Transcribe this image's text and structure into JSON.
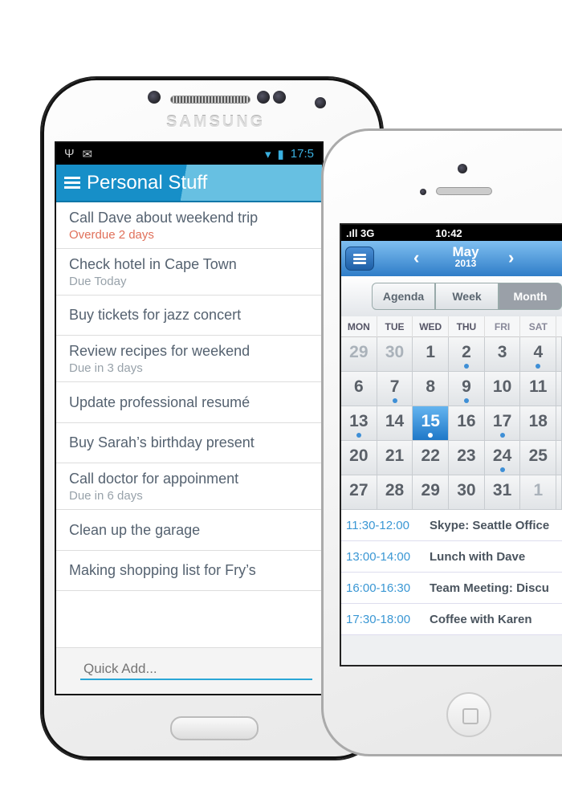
{
  "android": {
    "brand": "SAMSUNG",
    "status": {
      "time": "17:5"
    },
    "header": {
      "title": "Personal Stuff"
    },
    "tasks": [
      {
        "title": "Call Dave about weekend trip",
        "sub": "Overdue 2 days",
        "overdue": true
      },
      {
        "title": "Check hotel in Cape Town",
        "sub": "Due Today"
      },
      {
        "title": "Buy tickets for jazz concert"
      },
      {
        "title": "Review recipes for weekend",
        "sub": "Due in 3 days"
      },
      {
        "title": "Update professional resumé"
      },
      {
        "title": "Buy Sarah’s birthday present"
      },
      {
        "title": "Call doctor for appoinment",
        "sub": "Due in 6 days"
      },
      {
        "title": "Clean up the garage"
      },
      {
        "title": "Making shopping list for Fry’s"
      }
    ],
    "quick_add": {
      "placeholder": "Quick Add..."
    }
  },
  "iphone": {
    "status": {
      "signal": ".ıll 3G",
      "time": "10:42"
    },
    "nav": {
      "month": "May",
      "year": "2013",
      "prev": "‹",
      "next": "›"
    },
    "tabs": [
      {
        "label": "Agenda"
      },
      {
        "label": "Week"
      },
      {
        "label": "Month",
        "active": true
      }
    ],
    "weekdays": [
      "MON",
      "TUE",
      "WED",
      "THU",
      "FRI",
      "SAT"
    ],
    "days": [
      {
        "d": "29",
        "other": true
      },
      {
        "d": "30",
        "other": true
      },
      {
        "d": "1"
      },
      {
        "d": "2",
        "dot": true
      },
      {
        "d": "3"
      },
      {
        "d": "4",
        "dot": true
      },
      {
        "d": ""
      },
      {
        "d": "6"
      },
      {
        "d": "7",
        "dot": true
      },
      {
        "d": "8"
      },
      {
        "d": "9",
        "dot": true
      },
      {
        "d": "10"
      },
      {
        "d": "11"
      },
      {
        "d": ""
      },
      {
        "d": "13",
        "dot": true
      },
      {
        "d": "14"
      },
      {
        "d": "15",
        "selected": true,
        "dot": true
      },
      {
        "d": "16"
      },
      {
        "d": "17",
        "dot": true
      },
      {
        "d": "18"
      },
      {
        "d": ""
      },
      {
        "d": "20"
      },
      {
        "d": "21"
      },
      {
        "d": "22"
      },
      {
        "d": "23"
      },
      {
        "d": "24",
        "dot": true
      },
      {
        "d": "25"
      },
      {
        "d": ""
      },
      {
        "d": "27"
      },
      {
        "d": "28"
      },
      {
        "d": "29"
      },
      {
        "d": "30"
      },
      {
        "d": "31"
      },
      {
        "d": "1",
        "other": true
      },
      {
        "d": ""
      }
    ],
    "events": [
      {
        "time": "11:30-12:00",
        "title": "Skype: Seattle Office"
      },
      {
        "time": "13:00-14:00",
        "title": "Lunch with Dave"
      },
      {
        "time": "16:00-16:30",
        "title": "Team Meeting: Discu"
      },
      {
        "time": "17:30-18:00",
        "title": "Coffee with Karen"
      }
    ]
  },
  "colors": {
    "android_accent": "#1b98d0",
    "overdue": "#e0705a",
    "ios_blue": "#2f7dc8"
  }
}
